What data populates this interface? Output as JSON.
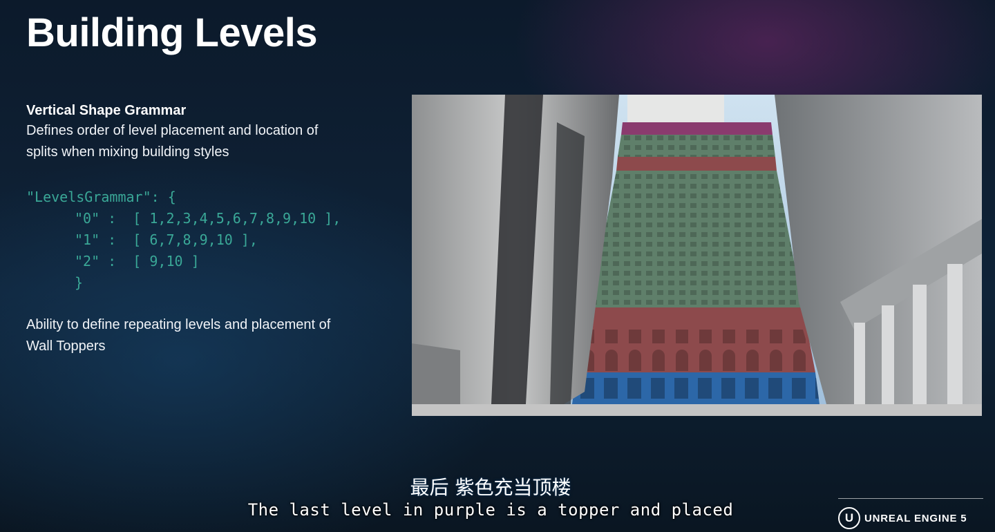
{
  "slide": {
    "title": "Building Levels",
    "subhead": "Vertical Shape Grammar",
    "description_line1": "Defines order of level placement and location of",
    "description_line2": "splits when mixing building styles",
    "code": {
      "line0": "\"LevelsGrammar\": {",
      "line1": "\"0\" :  [ 1,2,3,4,5,6,7,8,9,10 ],",
      "line2": "\"1\" :  [ 6,7,8,9,10 ],",
      "line3": "\"2\" :  [ 9,10 ]",
      "line4": "}"
    },
    "ability_line1": "Ability to define repeating levels and placement of",
    "ability_line2": "Wall Toppers"
  },
  "scene": {
    "description_colors": {
      "topper": "#8a3b6e",
      "green_levels": "#5f7f6a",
      "red_levels": "#8d4a4c",
      "blue_levels": "#2c67a8"
    }
  },
  "captions": {
    "chinese": "最后 紫色充当顶楼",
    "english": "The last level in purple is a topper and placed"
  },
  "branding": {
    "logo_mark": "U",
    "logo_text": "UNREAL ENGINE 5"
  }
}
